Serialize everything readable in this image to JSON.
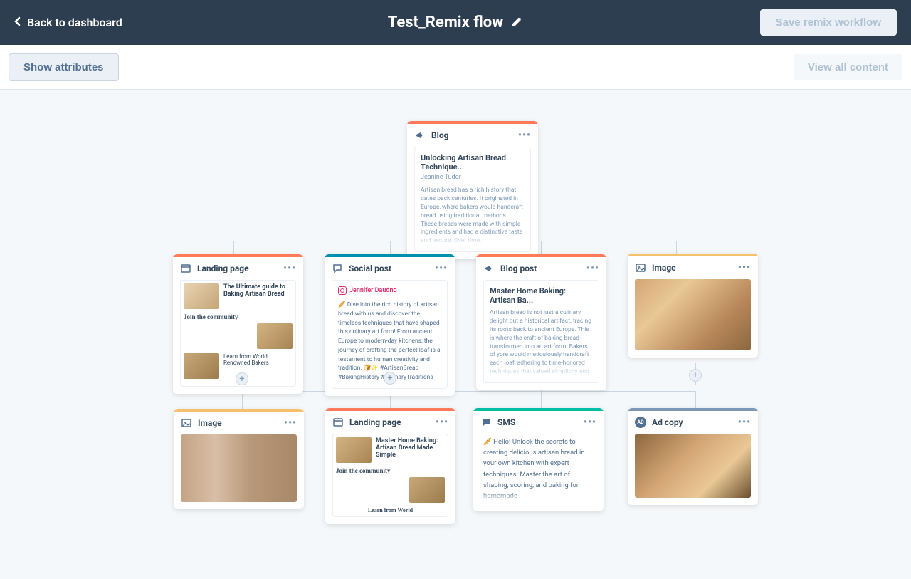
{
  "header": {
    "back_label": "Back to dashboard",
    "title": "Test_Remix flow",
    "save_label": "Save remix workflow"
  },
  "subheader": {
    "show_attributes_label": "Show attributes",
    "view_all_label": "View all content"
  },
  "root_card": {
    "type_label": "Blog",
    "title": "Unlocking Artisan Bread Technique...",
    "author": "Jeanine Tudor",
    "body": "Artisan bread has a rich history that dates back centuries. It originated in Europe, where bakers would handcraft bread using traditional methods. These breads were made with simple ingredients and had a distinctive taste and texture. Over time,",
    "bar_color": "#ff7a59"
  },
  "row1": [
    {
      "type_label": "Landing page",
      "bar_color": "#ff7a59",
      "lp_title": "The Ultimate guide to Baking Artisan Bread",
      "lp_community": "Join the community",
      "lp_learn": "Learn from World Renowned Bakers"
    },
    {
      "type_label": "Social post",
      "bar_color": "#0091ae",
      "author": "Jennifer Daudno",
      "body": "🥖 Dive into the rich history of artisan bread with us and discover the timeless techniques that have shaped this culinary art form! From ancient Europe to modern-day kitchens, the journey of crafting the perfect loaf is a testament to human creativity and tradition. 🍞✨ #ArtisanBread #BakingHistory #CulinaryTraditions"
    },
    {
      "type_label": "Blog post",
      "bar_color": "#ff7a59",
      "title": "Master Home Baking: Artisan Ba...",
      "body": "Artisan bread is not just a culinary delight but a historical artifact, tracing its roots back to ancient Europe. This is where the craft of baking bread transformed into an art form. Bakers of yore would meticulously handcraft each loaf, adhering to time-honored techniques that valued simplicity and"
    },
    {
      "type_label": "Image",
      "bar_color": "#f5c26b"
    }
  ],
  "row2": [
    {
      "type_label": "Image",
      "bar_color": "#f5c26b"
    },
    {
      "type_label": "Landing page",
      "bar_color": "#ff7a59",
      "lp_title": "Master Home Baking: Artisan Bread Made Simple",
      "lp_community": "Join the community",
      "lp_learn": "Learn from World"
    },
    {
      "type_label": "SMS",
      "bar_color": "#00bda5",
      "body": "🥖 Hello! Unlock the secrets to creating delicious artisan bread in your own kitchen with expert techniques. Master the art of shaping, scoring, and baking for homemade"
    },
    {
      "type_label": "Ad copy",
      "bar_color": "#7c98b6",
      "badge": "AD"
    }
  ]
}
